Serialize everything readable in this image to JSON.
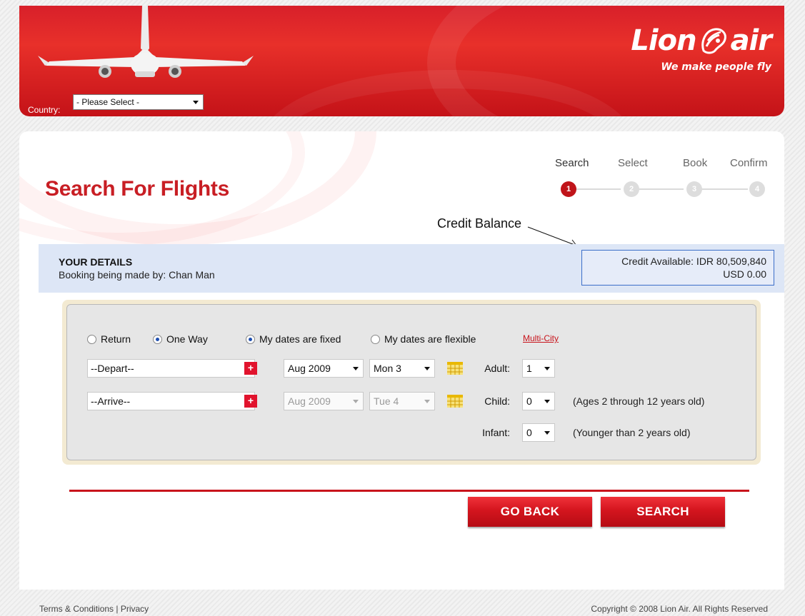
{
  "header": {
    "country_label": "Country:",
    "country_value": "- Please Select -",
    "logo_word1": "Lion",
    "logo_word2": "air",
    "tagline": "We make people fly"
  },
  "page": {
    "title": "Search For Flights"
  },
  "steps": [
    {
      "label": "Search",
      "number": "1",
      "active": true
    },
    {
      "label": "Select",
      "number": "2",
      "active": false
    },
    {
      "label": "Book",
      "number": "3",
      "active": false
    },
    {
      "label": "Confirm",
      "number": "4",
      "active": false
    }
  ],
  "annotation": {
    "credit_balance": "Credit Balance"
  },
  "details": {
    "title": "YOUR DETAILS",
    "booking_by": "Booking being made by: Chan Man",
    "credit_idr": "Credit Available: IDR 80,509,840",
    "credit_usd": "USD 0.00"
  },
  "form": {
    "trip_return": "Return",
    "trip_oneway": "One Way",
    "trip_selected": "One Way",
    "dates_fixed": "My dates are fixed",
    "dates_flexible": "My dates are flexible",
    "dates_selected": "My dates are fixed",
    "multi_city": "Multi-City",
    "depart_value": "--Depart--",
    "arrive_value": "--Arrive--",
    "plus": "+",
    "depart_month": "Aug 2009",
    "depart_day": "Mon 3",
    "arrive_month": "Aug 2009",
    "arrive_day": "Tue 4",
    "adult_label": "Adult:",
    "adult_value": "1",
    "child_label": "Child:",
    "child_value": "0",
    "child_note": "(Ages 2 through 12 years old)",
    "infant_label": "Infant:",
    "infant_value": "0",
    "infant_note": "(Younger than 2 years old)"
  },
  "buttons": {
    "go_back": "GO BACK",
    "search": "SEARCH"
  },
  "footer": {
    "links": "Terms & Conditions | Privacy",
    "copyright": "Copyright © 2008 Lion Air. All Rights Reserved"
  },
  "colors": {
    "brand_red": "#c81e24",
    "details_bg": "#dde6f6",
    "credit_border": "#3b6ec8"
  }
}
